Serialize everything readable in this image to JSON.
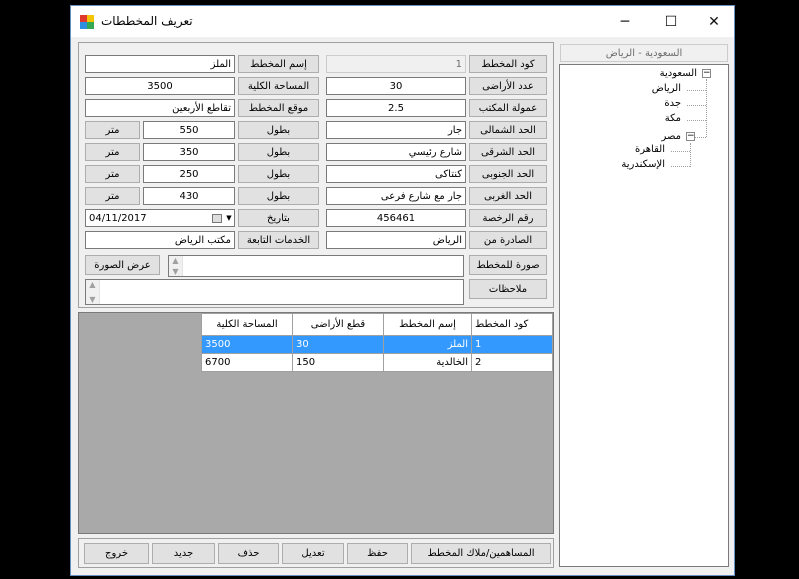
{
  "window": {
    "title": "تعريف المخططات",
    "minimize": "─",
    "maximize": "☐",
    "close": "✕"
  },
  "form": {
    "plan_code": {
      "label": "كود المخطط",
      "value": "1"
    },
    "plan_name": {
      "label": "إسم المخطط",
      "value": "الملز"
    },
    "land_count": {
      "label": "عدد الأراضى",
      "value": "30"
    },
    "total_area": {
      "label": "المساحة الكلية",
      "value": "3500"
    },
    "office_commission": {
      "label": "عمولة المكتب",
      "value": "2.5"
    },
    "plan_location": {
      "label": "موقع المخطط",
      "value": "تقاطع الأربعين"
    },
    "borders": [
      {
        "label": "الحد الشمالى",
        "value": "جار",
        "length_label": "بطول",
        "length": "550",
        "unit": "متر"
      },
      {
        "label": "الحد الشرقى",
        "value": "شارع رئيسي",
        "length_label": "بطول",
        "length": "350",
        "unit": "متر"
      },
      {
        "label": "الحد الجنوبى",
        "value": "كنتاكى",
        "length_label": "بطول",
        "length": "250",
        "unit": "متر"
      },
      {
        "label": "الحد الغربى",
        "value": "جار مع شارع فرعى",
        "length_label": "بطول",
        "length": "430",
        "unit": "متر"
      }
    ],
    "license_number": {
      "label": "رقم الرخصة",
      "value": "456461"
    },
    "date": {
      "label": "بتاريخ",
      "value": "04/11/2017"
    },
    "issued_from": {
      "label": "الصادرة من",
      "value": "الرياض"
    },
    "services": {
      "label": "الخدمات التابعة",
      "value": "مكتب الرياض"
    },
    "plan_image": {
      "label": "صورة للمخطط",
      "view_label": "عرض الصورة"
    },
    "notes": {
      "label": "ملاحظات"
    }
  },
  "grid": {
    "columns": [
      "كود المخطط",
      "إسم المخطط",
      "قطع الأراضى",
      "المساحة الكلية"
    ],
    "rows": [
      {
        "code": "1",
        "name": "الملز",
        "lands": "30",
        "area": "3500",
        "selected": true
      },
      {
        "code": "2",
        "name": "الخالدية",
        "lands": "150",
        "area": "6700",
        "selected": false
      }
    ]
  },
  "actions": {
    "shareholders": "المساهمين/ملاك المخطط",
    "save": "حفظ",
    "edit": "تعديل",
    "delete": "حذف",
    "new": "جديد",
    "exit": "خروج"
  },
  "tree": {
    "header": "السعودية - الرياض",
    "nodes": [
      {
        "label": "السعودية",
        "children": [
          "الرياض",
          "جدة",
          "مكة"
        ]
      },
      {
        "label": "مصر",
        "children": [
          "القاهرة",
          "الإسكندرية"
        ]
      }
    ]
  }
}
